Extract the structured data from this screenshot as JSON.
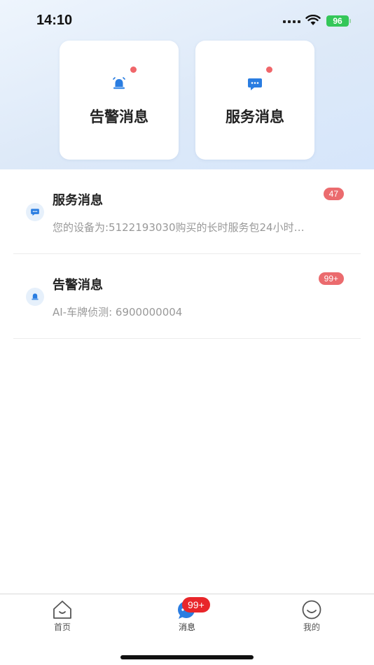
{
  "status_bar": {
    "time": "14:10",
    "battery": "96"
  },
  "categories": [
    {
      "label": "告警消息",
      "icon": "alarm-bell-icon",
      "has_dot": true
    },
    {
      "label": "服务消息",
      "icon": "chat-bubble-icon",
      "has_dot": true
    }
  ],
  "messages": [
    {
      "title": "服务消息",
      "preview": "您的设备为:5122193030购买的长时服务包24小时…",
      "badge": "47",
      "icon": "chat-bubble-icon"
    },
    {
      "title": "告警消息",
      "preview": "AI-车牌侦测: 6900000004",
      "badge": "99+",
      "icon": "alarm-bell-icon"
    }
  ],
  "tab_bar": {
    "home": {
      "label": "首页",
      "icon": "home-icon"
    },
    "messages": {
      "label": "消息",
      "icon": "message-icon",
      "badge": "99+"
    },
    "me": {
      "label": "我的",
      "icon": "smiley-icon"
    }
  },
  "colors": {
    "accent": "#2a7de1",
    "badge": "#eb6b6e",
    "tab_badge": "#e8262a",
    "battery": "#34c759"
  }
}
